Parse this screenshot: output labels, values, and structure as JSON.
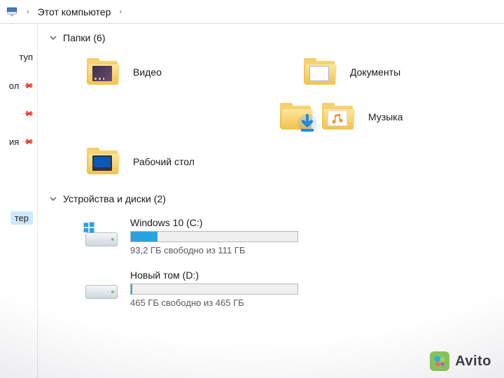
{
  "breadcrumb": {
    "location": "Этот компьютер"
  },
  "sidebar": {
    "items": [
      {
        "label": "туп"
      },
      {
        "label": "ол"
      },
      {
        "label": "ия"
      },
      {
        "label": "тер"
      }
    ]
  },
  "groups": {
    "folders": {
      "title": "Папки",
      "count_suffix": "(6)"
    },
    "drives": {
      "title": "Устройства и диски",
      "count_suffix": "(2)"
    }
  },
  "folders": [
    {
      "key": "video",
      "label": "Видео",
      "icon": "video-folder-icon"
    },
    {
      "key": "documents",
      "label": "Документы",
      "icon": "documents-folder-icon"
    },
    {
      "key": "downloads",
      "label": "",
      "icon": "downloads-folder-icon"
    },
    {
      "key": "music",
      "label": "Музыка",
      "icon": "music-folder-icon"
    },
    {
      "key": "desktop",
      "label": "Рабочий стол",
      "icon": "desktop-folder-icon"
    }
  ],
  "drives": [
    {
      "key": "c",
      "name": "Windows 10 (C:)",
      "free_text": "93,2 ГБ свободно из 111 ГБ",
      "used_fraction": 0.16,
      "os_badge": true
    },
    {
      "key": "d",
      "name": "Новый том (D:)",
      "free_text": "465 ГБ свободно из 465 ГБ",
      "used_fraction": 0.01,
      "os_badge": false
    }
  ],
  "watermark": {
    "text": "Avito"
  },
  "colors": {
    "accent": "#29a3e0",
    "folder": "#f3c24b"
  }
}
